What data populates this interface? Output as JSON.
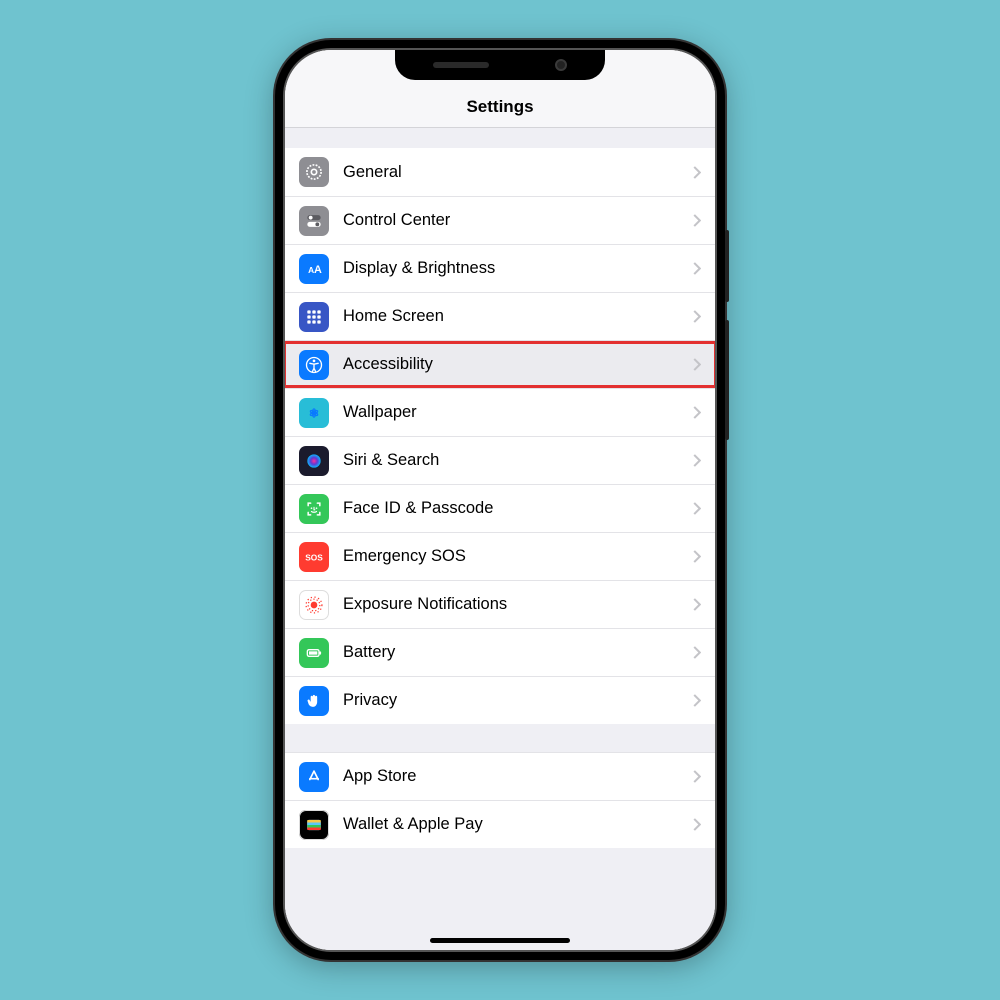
{
  "header": {
    "title": "Settings"
  },
  "groups": [
    {
      "items": [
        {
          "id": "general",
          "label": "General",
          "icon": "gear",
          "bg": "#8e8e93",
          "highlight": false
        },
        {
          "id": "control-center",
          "label": "Control Center",
          "icon": "toggles",
          "bg": "#8e8e93",
          "highlight": false
        },
        {
          "id": "display-brightness",
          "label": "Display & Brightness",
          "icon": "aa",
          "bg": "#0a7aff",
          "highlight": false
        },
        {
          "id": "home-screen",
          "label": "Home Screen",
          "icon": "grid",
          "bg": "#3856c5",
          "highlight": false
        },
        {
          "id": "accessibility",
          "label": "Accessibility",
          "icon": "accessibility",
          "bg": "#0a7aff",
          "highlight": true
        },
        {
          "id": "wallpaper",
          "label": "Wallpaper",
          "icon": "flower",
          "bg": "#28bdd7",
          "highlight": false
        },
        {
          "id": "siri-search",
          "label": "Siri & Search",
          "icon": "siri",
          "bg": "#1b1b2d",
          "highlight": false
        },
        {
          "id": "faceid-passcode",
          "label": "Face ID & Passcode",
          "icon": "faceid",
          "bg": "#34c759",
          "highlight": false
        },
        {
          "id": "emergency-sos",
          "label": "Emergency SOS",
          "icon": "sos",
          "bg": "#ff3b30",
          "highlight": false
        },
        {
          "id": "exposure-notifications",
          "label": "Exposure Notifications",
          "icon": "exposure",
          "bg": "#ffffff",
          "highlight": false
        },
        {
          "id": "battery",
          "label": "Battery",
          "icon": "battery",
          "bg": "#34c759",
          "highlight": false
        },
        {
          "id": "privacy",
          "label": "Privacy",
          "icon": "hand",
          "bg": "#0a7aff",
          "highlight": false
        }
      ]
    },
    {
      "items": [
        {
          "id": "app-store",
          "label": "App Store",
          "icon": "appstore",
          "bg": "#0a7aff",
          "highlight": false
        },
        {
          "id": "wallet-apple-pay",
          "label": "Wallet & Apple Pay",
          "icon": "wallet",
          "bg": "#000000",
          "highlight": false
        }
      ]
    }
  ]
}
